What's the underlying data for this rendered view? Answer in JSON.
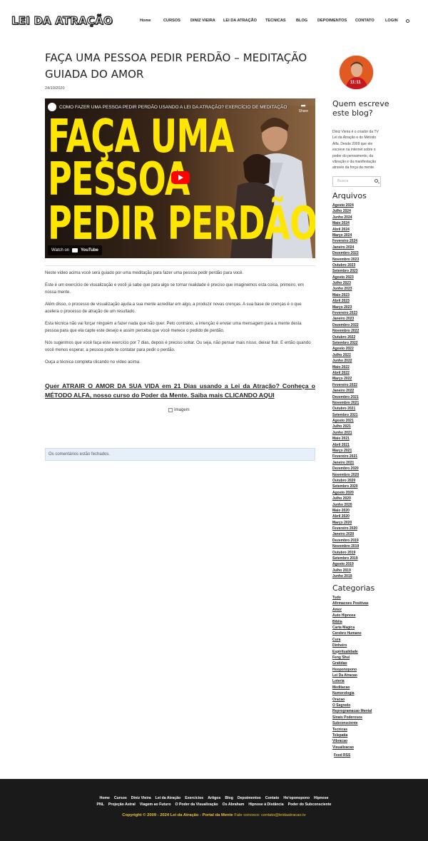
{
  "site": {
    "logo_text": "LEI DA ATRAÇÃO",
    "nav": [
      "Home",
      "CURSOS",
      "DINIZ VIEIRA",
      "LEI DA ATRAÇÃO",
      "TECNICAS",
      "BLOG",
      "DEPOIMENTOS",
      "CONTATO",
      "LOGIN"
    ]
  },
  "post": {
    "title_line1": "FAÇA UMA PESSOA PEDIR PERDÃO – MEDITAÇÃO",
    "title_line2": "GUIADA DO AMOR",
    "date": "24/10/2020",
    "video": {
      "title": "COMO FAZER UMA PESSOA PEDIR PERDÃO USANDO A LEI DA ATRAÇÃO? EXERCÍCIO DE MEDITAÇÃO",
      "share": "Share",
      "overlay_line1": "FAÇA UMA",
      "overlay_line2": "PESSOA",
      "overlay_line3": "PEDIR PERDÃO",
      "watch_on": "Watch on",
      "youtube": "YouTube"
    },
    "paragraphs": [
      "Neste vídeo acima você será guiado por uma meditação para fazer uma pessoa pedir perdão para você.",
      "Este é um exercício de visualização e você já sabe que para algo se tornar realidade é preciso que imaginemos esta coisa, primeiro, em nossa mente.",
      "Além disso, o processo de visualização ajuda a sua mente acreditar em algo, a produzir novas crenças. A sua base de crenças é o que acelera o processo de atração de um resultado.",
      "Esta técnica não vai forçar ninguém a fazer nada que não quer. Pelo contrário, a intenção é enviar uma mensagem para a mente desta pessoa para que ela capte este desejo e assim perceba que você merece o pedido de perdão.",
      "Nós sugerimos que você faça este exercício por 7 dias, depois é preciso soltar. Ou seja, não pensar mais nisso, deixar fluir. E então quando você menos esperar, a pessoa pode te contatar para pedir o perdão.",
      "Ouça a técnica completa clicando no vídeo acima."
    ],
    "cta": "Quer ATRAIR O AMOR DA SUA VIDA em 21 Dias usando a Lei da Atração? Conheça o MÉTODO ALFA, nosso curso do Poder da Mente. Saiba mais CLICANDO AQUI",
    "image_alt": "Imagem",
    "comments_closed": "Os comentários estão fechados."
  },
  "sidebar": {
    "avatar_badge": "11:11",
    "about_heading": "Quem escreve este blog?",
    "about_text": "Diniz Vieira é o criador da TV Lei da Atração e do Método Alfa. Desde 2009 que ele escreve na internet sobre o poder do pensamento, da vibração e da manifestação através da força da mente.",
    "search_placeholder": "Busca",
    "archives_heading": "Arquivos",
    "archives": [
      "Agosto 2024",
      "Julho 2024",
      "Junho 2024",
      "Maio 2024",
      "Abril 2024",
      "Março 2024",
      "Fevereiro 2024",
      "Janeiro 2024",
      "Dezembro 2023",
      "Novembro 2023",
      "Outubro 2023",
      "Setembro 2023",
      "Agosto 2023",
      "Julho 2023",
      "Junho 2023",
      "Maio 2023",
      "Abril 2023",
      "Março 2023",
      "Fevereiro 2023",
      "Janeiro 2023",
      "Dezembro 2022",
      "Novembro 2022",
      "Outubro 2022",
      "Setembro 2022",
      "Agosto 2022",
      "Julho 2022",
      "Junho 2022",
      "Maio 2022",
      "Abril 2022",
      "Março 2022",
      "Fevereiro 2022",
      "Janeiro 2022",
      "Dezembro 2021",
      "Novembro 2021",
      "Outubro 2021",
      "Setembro 2021",
      "Agosto 2021",
      "Julho 2021",
      "Junho 2021",
      "Maio 2021",
      "Abril 2021",
      "Março 2021",
      "Fevereiro 2021",
      "Janeiro 2021",
      "Dezembro 2020",
      "Novembro 2020",
      "Outubro 2020",
      "Setembro 2020",
      "Agosto 2020",
      "Julho 2020",
      "Junho 2020",
      "Maio 2020",
      "Abril 2020",
      "Março 2020",
      "Fevereiro 2020",
      "Janeiro 2020",
      "Dezembro 2019",
      "Novembro 2019",
      "Outubro 2019",
      "Setembro 2019",
      "Agosto 2019",
      "Julho 2019",
      "Junho 2019"
    ],
    "categories_heading": "Categorias",
    "categories": [
      "Tudo",
      "Afirmacoes Positivas",
      "Amor",
      "Auto Hipnose",
      "Biblia",
      "Carta Magica",
      "Cerebro Humano",
      "Cura",
      "Dinheiro",
      "Espiritualidade",
      "Feng Shui",
      "Gratidao",
      "Hooponopono",
      "Lei Da Atracao",
      "Loteria",
      "Meditacao",
      "Numerologia",
      "Oracao",
      "O Segredo",
      "Reprogramacao Mental",
      "Sinais Poderosos",
      "Subconsciente",
      "Tecnicas",
      "Telepatia",
      "Vibracao",
      "Visualizacao"
    ],
    "feed": "Feed RSS"
  },
  "footer": {
    "row1": [
      "Home",
      "Cursos",
      "Diniz Vieira",
      "Lei da Atração",
      "Exercícios",
      "Artigos",
      "Blog",
      "Depoimentos",
      "Contato",
      "Ho'oponopono",
      "Hipnose"
    ],
    "row2": [
      "PNL",
      "Projeção Astral",
      "Viagem ao Futuro",
      "O Poder da Visualização",
      "Os Abraham",
      "Hipnose à Distância",
      "Poder do Subconsciente"
    ],
    "copyright": "Copyright © 2009 - 2024 Lei da Atração - Portal da Mente",
    "contact_label": "Fale conosco:",
    "email": "contato@leidaatracao.tv"
  },
  "colors": {
    "accent_yellow": "#ffe600",
    "footer_bg": "#1a1a1a",
    "copyright": "#e8c33a",
    "comments_bg": "#e7f0f8"
  }
}
